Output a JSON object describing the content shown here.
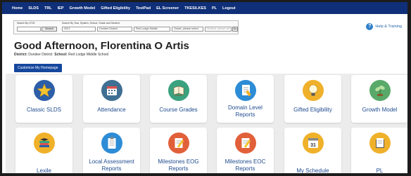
{
  "nav": {
    "items": [
      "Home",
      "SLDS",
      "TRL",
      "IEP",
      "Growth Model",
      "Gifted Eligibility",
      "TestPad",
      "EL Screener",
      "TKES/LKES",
      "PL",
      "Logout"
    ]
  },
  "search": {
    "by_id_label": "Search By GTID",
    "by_year_label": "Search By Year, System, School, Grade and Student",
    "search_button": "Search",
    "year_value": "2021",
    "district_value": "Dundee District",
    "school_value": "Red Lodge Middle",
    "grade_value": "Grade, please select",
    "student_placeholder": "Student, please sel",
    "go_button": "Go"
  },
  "help": {
    "label": "Help & Training"
  },
  "greeting": "Good Afternoon, Florentina O Artis",
  "context": {
    "district_label": "District:",
    "district_value": "Dundee District",
    "school_label": "School:",
    "school_value": "Red Lodge Middle School"
  },
  "customize_button": "Customize My Homepage",
  "tiles": [
    {
      "label": "Classic SLDS",
      "icon": "star-icon",
      "color": "#2d5ea8"
    },
    {
      "label": "Attendance",
      "icon": "calendar-icon",
      "color": "#3f6f93"
    },
    {
      "label": "Course Grades",
      "icon": "book-icon",
      "color": "#3aa27e"
    },
    {
      "label_1": "Domain Level",
      "label_2": "Reports",
      "icon": "report-icon",
      "color": "#2d8cd6"
    },
    {
      "label": "Gifted Eligibility",
      "icon": "lightbulb-icon",
      "color": "#f0b12a"
    },
    {
      "label": "Growth Model",
      "icon": "plant-icon",
      "color": "#59a96a"
    },
    {
      "label": "Lexile",
      "icon": "books-icon",
      "color": "#f0b12a"
    },
    {
      "label_1": "Local Assessment",
      "label_2": "Reports",
      "icon": "clipboard-icon",
      "color": "#2d8cd6"
    },
    {
      "label_1": "Milestones EOG",
      "label_2": "Reports",
      "icon": "pencil-paper-icon",
      "color": "#e1603a"
    },
    {
      "label_1": "Milestones EOC",
      "label_2": "Reports",
      "icon": "pencil-paper-icon",
      "color": "#e1603a"
    },
    {
      "label": "My Schedule",
      "icon": "calendar-31-icon",
      "color": "#f0b12a",
      "day": "31"
    },
    {
      "label": "PL",
      "icon": "folder-icon",
      "color": "#f0b12a"
    }
  ]
}
